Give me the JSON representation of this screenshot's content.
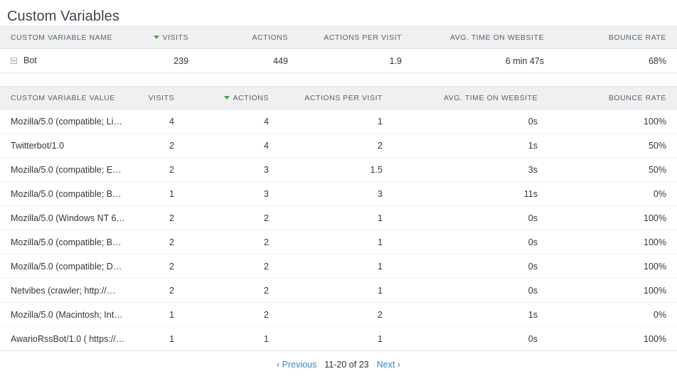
{
  "page_title": "Custom Variables",
  "colors": {
    "header_bg": "#eff0f1",
    "header_text": "#5b6268",
    "sort_arrow": "#4c9b4c",
    "link": "#3787c9",
    "body_text": "#32373c",
    "row_border": "#f0f1f2"
  },
  "summary_table": {
    "columns": [
      {
        "label": "Custom Variable Name",
        "align": "left",
        "sorted": false
      },
      {
        "label": "Visits",
        "align": "right",
        "sorted": true
      },
      {
        "label": "Actions",
        "align": "right",
        "sorted": false
      },
      {
        "label": "Actions per Visit",
        "align": "right",
        "sorted": false
      },
      {
        "label": "Avg. Time on Website",
        "align": "right",
        "sorted": false
      },
      {
        "label": "Bounce Rate",
        "align": "right",
        "sorted": false
      }
    ],
    "rows": [
      {
        "name": "Bot",
        "expand_icon": "minus-box-icon",
        "visits": "239",
        "actions": "449",
        "actions_per_visit": "1.9",
        "avg_time_on_website": "6 min 47s",
        "bounce_rate": "68%"
      }
    ]
  },
  "detail_table": {
    "columns": [
      {
        "label": "Custom Variable Value",
        "align": "left",
        "sorted": false
      },
      {
        "label": "Visits",
        "align": "right",
        "sorted": false
      },
      {
        "label": "Actions",
        "align": "right",
        "sorted": true
      },
      {
        "label": "Actions per Visit",
        "align": "right",
        "sorted": false
      },
      {
        "label": "Avg. Time on Website",
        "align": "right",
        "sorted": false
      },
      {
        "label": "Bounce Rate",
        "align": "right",
        "sorted": false
      }
    ],
    "rows": [
      {
        "value": "Mozilla/5.0 (compatible; Li…",
        "visits": "4",
        "actions": "4",
        "actions_per_visit": "1",
        "avg_time_on_website": "0s",
        "bounce_rate": "100%"
      },
      {
        "value": "Twitterbot/1.0",
        "visits": "2",
        "actions": "4",
        "actions_per_visit": "2",
        "avg_time_on_website": "1s",
        "bounce_rate": "50%"
      },
      {
        "value": "Mozilla/5.0 (compatible; E…",
        "visits": "2",
        "actions": "3",
        "actions_per_visit": "1.5",
        "avg_time_on_website": "3s",
        "bounce_rate": "50%"
      },
      {
        "value": "Mozilla/5.0 (compatible; B…",
        "visits": "1",
        "actions": "3",
        "actions_per_visit": "3",
        "avg_time_on_website": "11s",
        "bounce_rate": "0%"
      },
      {
        "value": "Mozilla/5.0 (Windows NT 6…",
        "visits": "2",
        "actions": "2",
        "actions_per_visit": "1",
        "avg_time_on_website": "0s",
        "bounce_rate": "100%"
      },
      {
        "value": "Mozilla/5.0 (compatible; B…",
        "visits": "2",
        "actions": "2",
        "actions_per_visit": "1",
        "avg_time_on_website": "0s",
        "bounce_rate": "100%"
      },
      {
        "value": "Mozilla/5.0 (compatible; D…",
        "visits": "2",
        "actions": "2",
        "actions_per_visit": "1",
        "avg_time_on_website": "0s",
        "bounce_rate": "100%"
      },
      {
        "value": "Netvibes (crawler; http://…",
        "visits": "2",
        "actions": "2",
        "actions_per_visit": "1",
        "avg_time_on_website": "0s",
        "bounce_rate": "100%"
      },
      {
        "value": "Mozilla/5.0 (Macintosh; Int…",
        "visits": "1",
        "actions": "2",
        "actions_per_visit": "2",
        "avg_time_on_website": "1s",
        "bounce_rate": "0%"
      },
      {
        "value": "AwarioRssBot/1.0 ( https://…",
        "visits": "1",
        "actions": "1",
        "actions_per_visit": "1",
        "avg_time_on_website": "0s",
        "bounce_rate": "100%"
      }
    ]
  },
  "pagination": {
    "previous_label": "‹ Previous",
    "range_label": "11-20 of 23",
    "next_label": "Next ›"
  }
}
